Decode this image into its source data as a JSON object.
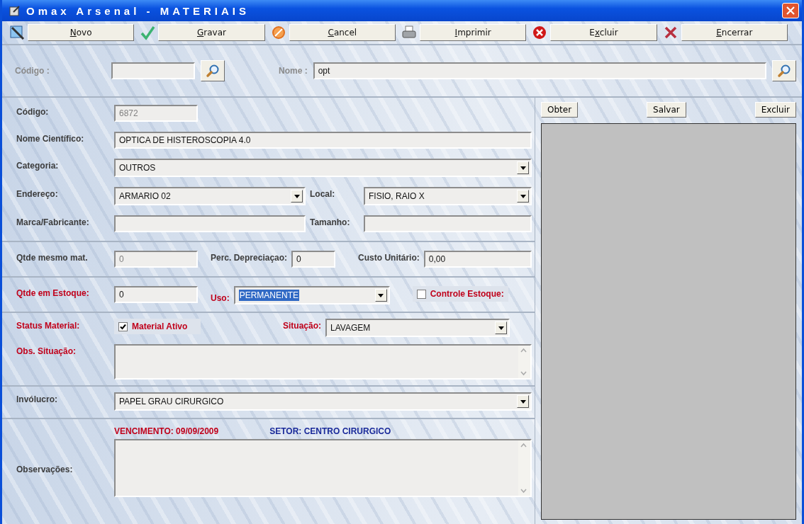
{
  "window": {
    "title": "Omax Arsenal - MATERIAIS"
  },
  "toolbar": [
    {
      "kind": "new",
      "label_key": "N",
      "label_post": "ovo"
    },
    {
      "kind": "save",
      "label_key": "G",
      "label_post": "ravar"
    },
    {
      "kind": "cancel",
      "label_key": "C",
      "label_post": "ancel"
    },
    {
      "kind": "print",
      "label_key": "I",
      "label_post": "mprimir"
    },
    {
      "kind": "delete",
      "label_pre": "E",
      "label_key": "x",
      "label_post": "cluir"
    },
    {
      "kind": "close",
      "label_key": "E",
      "label_post": "ncerrar"
    }
  ],
  "search": {
    "code_label": "Código :",
    "name_label": "Nome :",
    "name_value": "opt"
  },
  "codigo": {
    "label": "Código:",
    "value": "6872",
    "disabled": true
  },
  "nome_cientifico": {
    "label": "Nome Científico:",
    "value": "OPTICA DE HISTEROSCOPIA 4.0",
    "disabled": false
  },
  "categoria": {
    "label": "Categoria:",
    "value": "OUTROS"
  },
  "endereco": {
    "label": "Endereço:",
    "value": "ARMARIO 02"
  },
  "local": {
    "label": "Local:",
    "value": "FISIO, RAIO X"
  },
  "marca": {
    "label": "Marca/Fabricante:"
  },
  "tamanho": {
    "label": "Tamanho:"
  },
  "qtde_mesmo": {
    "label": "Qtde mesmo mat.",
    "value": "0",
    "disabled": true
  },
  "perc": {
    "label": "Perc. Depreciaçao:",
    "value": "0",
    "disabled": false
  },
  "custo": {
    "label": "Custo Unitário:",
    "value": "0,00",
    "disabled": false
  },
  "qtde_estoque": {
    "label": "Qtde em Estoque:",
    "value": "0",
    "disabled": false,
    "red": true
  },
  "uso": {
    "label": "Uso:",
    "value": "PERMANENTE",
    "highlighted": true,
    "red": true
  },
  "controle_estoque": {
    "label": "Controle Estoque:",
    "checked": false
  },
  "status": {
    "label": "Status Material:",
    "red": true
  },
  "material_ativo": {
    "label": "Material Ativo",
    "checked": true
  },
  "situacao": {
    "label": "Situação:",
    "value": "LAVAGEM",
    "red": true
  },
  "obs_situacao": {
    "label": "Obs. Situação:",
    "red": true
  },
  "involucro": {
    "label": "Invólucro:",
    "value": "PAPEL GRAU CIRURGICO"
  },
  "vencimento": "VENCIMENTO: 09/09/2009",
  "setor": "SETOR: CENTRO CIRURGICO",
  "observacoes": {
    "label": "Observações:"
  },
  "image_panel": {
    "buttons": [
      "Obter",
      "Salvar",
      "Excluir"
    ]
  }
}
